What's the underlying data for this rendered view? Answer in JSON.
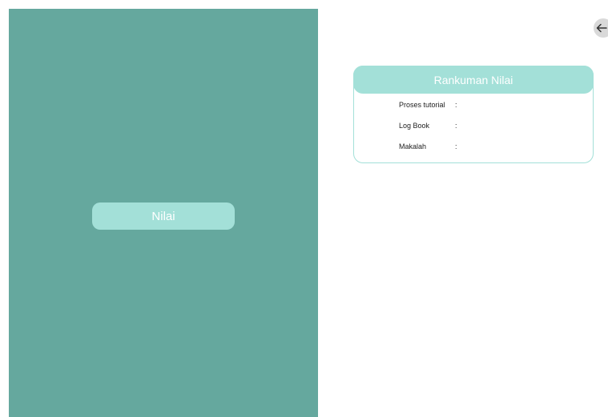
{
  "left_panel": {
    "button_label": "Nilai",
    "color": "#65a89e",
    "button_color": "#a3e0d8"
  },
  "back_button": {
    "icon": "arrow-left-icon"
  },
  "summary": {
    "title": "Rankuman Nilai",
    "rows": [
      {
        "label": "Proses tutorial",
        "sep": ":"
      },
      {
        "label": "Log Book",
        "sep": ":"
      },
      {
        "label": "Makalah",
        "sep": ":"
      }
    ]
  }
}
